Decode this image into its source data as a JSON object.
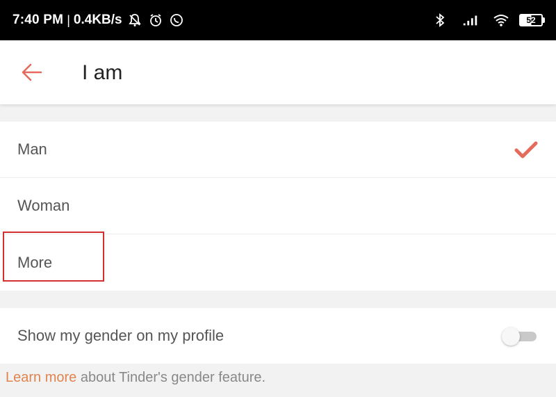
{
  "status_bar": {
    "time": "7:40 PM",
    "separator": "|",
    "net_speed": "0.4KB/s",
    "left_icons": [
      "notifications-off-icon",
      "alarm-icon",
      "whatsapp-icon"
    ],
    "right_icons": [
      "bluetooth-icon",
      "signal-icon",
      "wifi-icon"
    ],
    "battery_level": "52"
  },
  "header": {
    "back_icon": "arrow-left-icon",
    "title": "I am",
    "accent_color": "#e46a5e"
  },
  "options": [
    {
      "label": "Man",
      "selected": true
    },
    {
      "label": "Woman",
      "selected": false
    },
    {
      "label": "More",
      "selected": false
    }
  ],
  "toggle": {
    "label": "Show my gender on my profile",
    "enabled": false
  },
  "footer": {
    "link_text": "Learn more",
    "text": " about Tinder's gender feature."
  }
}
